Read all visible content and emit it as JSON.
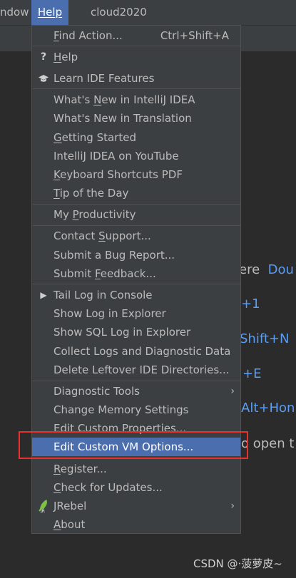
{
  "menubar": {
    "window_label": "ndow",
    "help_label": "Help",
    "project_name": "cloud2020"
  },
  "background_hints": [
    {
      "grey": "ere",
      "blue": "Dou"
    },
    {
      "grey": "",
      "blue": "+1"
    },
    {
      "grey": "",
      "blue": "Shift+N"
    },
    {
      "grey": "",
      "blue": "+E"
    },
    {
      "grey": "",
      "blue": "Alt+Hon"
    },
    {
      "grey": "o open t",
      "blue": ""
    }
  ],
  "menu": {
    "find_action": {
      "pre": "",
      "u": "F",
      "post": "ind Action...",
      "shortcut": "Ctrl+Shift+A"
    },
    "help": {
      "pre": "",
      "u": "H",
      "post": "elp",
      "icon": "question-icon"
    },
    "learn_ide": {
      "label": "Learn IDE Features",
      "icon": "graduation-cap-icon"
    },
    "whats_new_idea": {
      "pre": "What's ",
      "u": "N",
      "post": "ew in IntelliJ IDEA"
    },
    "whats_new_translation": {
      "label": "What's New in Translation"
    },
    "getting_started": {
      "pre": "",
      "u": "G",
      "post": "etting Started"
    },
    "youtube": {
      "label": "IntelliJ IDEA on YouTube"
    },
    "keyboard_pdf": {
      "pre": "",
      "u": "K",
      "post": "eyboard Shortcuts PDF"
    },
    "tip_of_day": {
      "pre": "",
      "u": "T",
      "post": "ip of the Day"
    },
    "productivity": {
      "pre": "My ",
      "u": "P",
      "post": "roductivity"
    },
    "contact_support": {
      "pre": "Contact ",
      "u": "S",
      "post": "upport..."
    },
    "submit_bug": {
      "label": "Submit a Bug Report..."
    },
    "submit_feedback": {
      "pre": "Submit ",
      "u": "F",
      "post": "eedback..."
    },
    "tail_log": {
      "label": "Tail Log in Console",
      "icon": "play-icon"
    },
    "show_log": {
      "label": "Show Log in Explorer"
    },
    "show_sql_log": {
      "label": "Show SQL Log in Explorer"
    },
    "collect_logs": {
      "label": "Collect Logs and Diagnostic Data"
    },
    "delete_leftover": {
      "label": "Delete Leftover IDE Directories..."
    },
    "diagnostic_tools": {
      "label": "Diagnostic Tools"
    },
    "change_memory": {
      "label": "Change Memory Settings"
    },
    "edit_properties": {
      "label": "Edit Custom Properties..."
    },
    "edit_vm_options": {
      "label": "Edit Custom VM Options..."
    },
    "register": {
      "pre": "",
      "u": "R",
      "post": "egister..."
    },
    "check_updates": {
      "pre": "",
      "u": "C",
      "post": "heck for Updates..."
    },
    "jrebel": {
      "label": "JRebel",
      "icon": "jrebel-icon"
    },
    "about": {
      "pre": "",
      "u": "A",
      "post": "bout"
    }
  },
  "watermark": "CSDN @·菠萝皮~",
  "colors": {
    "background": "#2b2b2b",
    "menu_bg": "#3c3f41",
    "selection": "#4b6eaf",
    "highlight_box": "#e8302e",
    "hint_blue": "#589df6"
  }
}
